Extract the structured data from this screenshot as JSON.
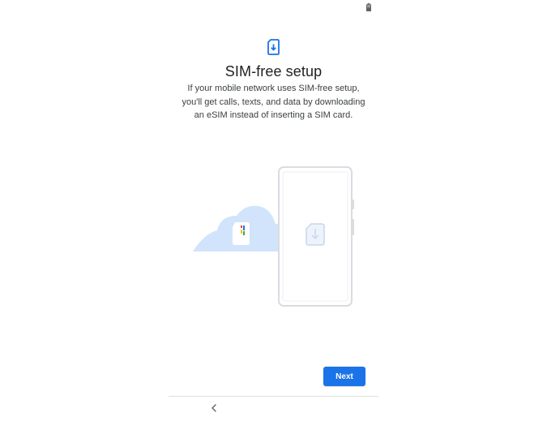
{
  "status_bar": {
    "battery_icon": "battery-icon"
  },
  "header": {
    "icon": "esim-download-icon",
    "title": "SIM-free setup",
    "description": "If your mobile network uses SIM-free setup, you'll get calls, texts, and data by downloading an eSIM instead of inserting a SIM card."
  },
  "illustration": {
    "cloud_icon": "cloud-icon",
    "sim_card_icon": "sim-card-icon",
    "phone_icon": "phone-icon",
    "esim_icon": "esim-download-icon"
  },
  "actions": {
    "next_label": "Next"
  },
  "nav": {
    "back_icon": "chevron-left-icon"
  },
  "colors": {
    "accent": "#1a73e8",
    "cloud": "#d2e3fc",
    "phone_outline": "#dadce0",
    "title_text": "#202124",
    "body_text": "#3c4043"
  }
}
